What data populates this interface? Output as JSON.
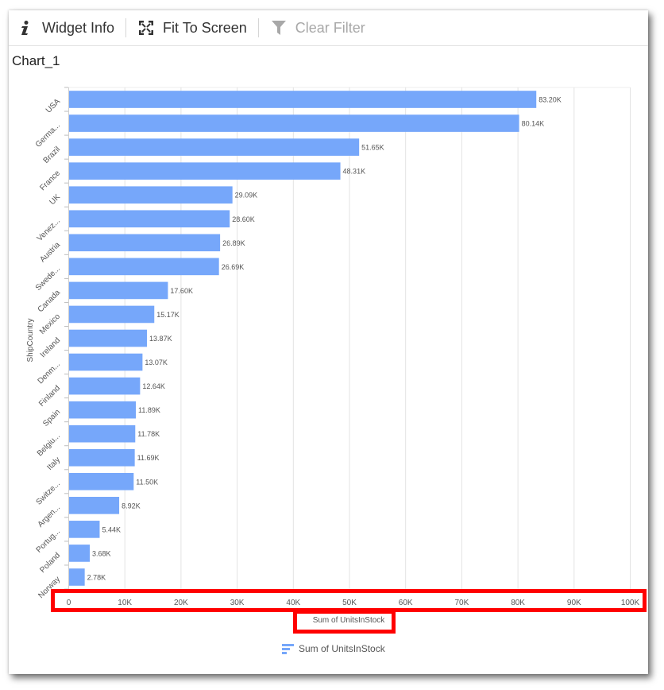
{
  "toolbar": {
    "widget_info_label": "Widget Info",
    "fit_to_screen_label": "Fit To Screen",
    "clear_filter_label": "Clear Filter",
    "icons": {
      "widget_info": "info-icon",
      "fit_to_screen": "expand-icon",
      "clear_filter": "filter-icon"
    }
  },
  "colors": {
    "bar": "#76a7fa",
    "highlight": "#ff0000",
    "grid": "#e0e0e0",
    "text": "#555555"
  },
  "chart_data": {
    "type": "bar",
    "orientation": "horizontal",
    "title": "Chart_1",
    "xlabel": "Sum of UnitsInStock",
    "ylabel": "ShipCountry",
    "categories": [
      "USA",
      "Germa...",
      "Brazil",
      "France",
      "UK",
      "Venez...",
      "Austria",
      "Swede...",
      "Canada",
      "Mexico",
      "Ireland",
      "Denm...",
      "Finland",
      "Spain",
      "Belgiu...",
      "Italy",
      "Switze...",
      "Argen...",
      "Portug...",
      "Poland",
      "Norway"
    ],
    "series": [
      {
        "name": "Sum of UnitsInStock",
        "values": [
          83200,
          80140,
          51650,
          48310,
          29090,
          28600,
          26890,
          26690,
          17600,
          15170,
          13870,
          13070,
          12640,
          11890,
          11780,
          11690,
          11500,
          8920,
          5440,
          3680,
          2780
        ],
        "labels": [
          "83.20K",
          "80.14K",
          "51.65K",
          "48.31K",
          "29.09K",
          "28.60K",
          "26.89K",
          "26.69K",
          "17.60K",
          "15.17K",
          "13.87K",
          "13.07K",
          "12.64K",
          "11.89K",
          "11.78K",
          "11.69K",
          "11.50K",
          "8.92K",
          "5.44K",
          "3.68K",
          "2.78K"
        ]
      }
    ],
    "xlim": [
      0,
      100000
    ],
    "xticks": [
      0,
      10000,
      20000,
      30000,
      40000,
      50000,
      60000,
      70000,
      80000,
      90000,
      100000
    ],
    "xtick_labels": [
      "0",
      "10K",
      "20K",
      "30K",
      "40K",
      "50K",
      "60K",
      "70K",
      "80K",
      "90K",
      "100K"
    ],
    "grid": true,
    "legend": {
      "position": "bottom-center",
      "entries": [
        "Sum of UnitsInStock"
      ]
    }
  }
}
